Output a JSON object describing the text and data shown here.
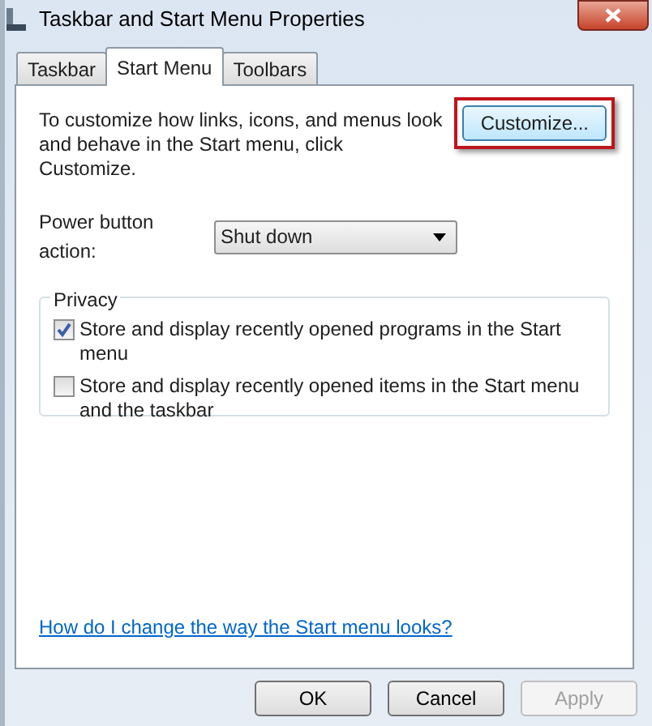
{
  "window": {
    "title": "Taskbar and Start Menu Properties"
  },
  "tabs": [
    {
      "label": "Taskbar",
      "selected": false
    },
    {
      "label": "Start Menu",
      "selected": true
    },
    {
      "label": "Toolbars",
      "selected": false
    }
  ],
  "intro": "To customize how links, icons, and menus look and behave in the Start menu, click Customize.",
  "customize_button": {
    "label": "Customize...",
    "highlighted": true
  },
  "power_button": {
    "label": "Power button action:",
    "value": "Shut down"
  },
  "privacy": {
    "title": "Privacy",
    "options": [
      {
        "label": "Store and display recently opened programs in the Start menu",
        "checked": true
      },
      {
        "label": "Store and display recently opened items in the Start menu and the taskbar",
        "checked": false
      }
    ]
  },
  "help_link": "How do I change the way the Start menu looks?",
  "buttons": [
    {
      "label": "OK",
      "disabled": false
    },
    {
      "label": "Cancel",
      "disabled": false
    },
    {
      "label": "Apply",
      "disabled": true
    }
  ]
}
